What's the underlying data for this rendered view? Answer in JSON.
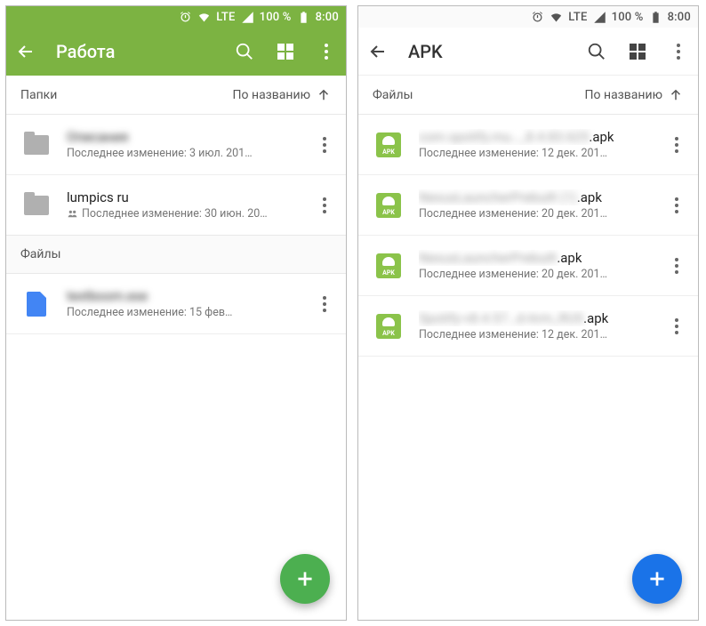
{
  "status": {
    "battery": "100 %",
    "time": "8:00",
    "net": "LTE"
  },
  "left": {
    "title": "Работа",
    "section_folders": "Папки",
    "section_files": "Файлы",
    "sort_label": "По названию",
    "folders": [
      {
        "name": "Описания",
        "sub": "Последнее изменение: 3 июл. 201…",
        "blur": true
      },
      {
        "name": "lumpics ru",
        "sub": "Последнее изменение: 30 июн. 20…",
        "blur": false,
        "shared": true
      }
    ],
    "files": [
      {
        "name": "textboom.exe",
        "sub": "Последнее изменение: 15 фев…",
        "blur": true
      }
    ]
  },
  "right": {
    "title": "APK",
    "section_files": "Файлы",
    "sort_label": "По названию",
    "files": [
      {
        "name_blur": "com.spotify.mu…_8.4.83.625",
        "ext": ".apk",
        "sub": "Последнее изменение: 12 дек. 201…"
      },
      {
        "name_blur": "NexusLauncherPrebuilt (1)",
        "ext": ".apk",
        "sub": "Последнее изменение: 20 дек. 201…"
      },
      {
        "name_blur": "NexusLauncherPrebuilt",
        "ext": ".apk",
        "sub": "Последнее изменение: 20 дек. 201…"
      },
      {
        "name_blur": "Spotify-v8.4.57…d-Arm_RUS",
        "ext": ".apk",
        "sub": "Последнее изменение: 12 дек. 201…"
      }
    ]
  }
}
